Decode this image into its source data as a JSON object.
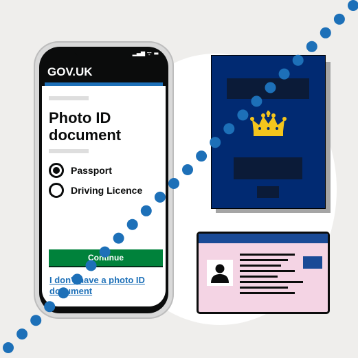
{
  "phone": {
    "header_title": "GOV.UK",
    "status_icons": "▂▄▆ ᯤ ▬",
    "page_title": "Photo ID document",
    "options": [
      {
        "label": "Passport",
        "checked": true
      },
      {
        "label": "Driving Licence",
        "checked": false
      }
    ],
    "continue_label": "Continue",
    "no_id_link": "I don't have a photo ID document"
  },
  "colors": {
    "govuk_black": "#0b0c0c",
    "govuk_blue": "#1d70b8",
    "button_green": "#00823b",
    "passport_blue": "#012a72",
    "crown_gold": "#f4c51c",
    "licence_pink": "#f4d4e4",
    "dots_blue": "#1d70b8"
  },
  "icons": [
    "crown-icon",
    "person-silhouette-icon",
    "signal-icon",
    "wifi-icon",
    "battery-icon"
  ]
}
